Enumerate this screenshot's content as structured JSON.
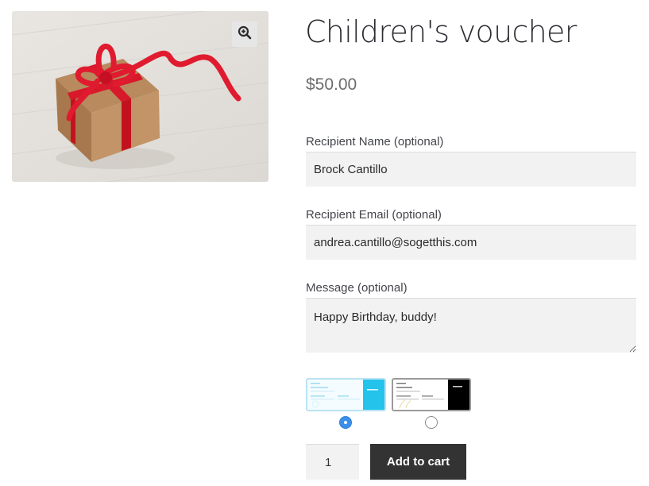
{
  "product": {
    "title": "Children's voucher",
    "price": "$50.00",
    "image_icon": "gift-box-with-red-ribbon",
    "zoom_icon": "magnifier-plus-icon"
  },
  "form": {
    "recipient_name": {
      "label": "Recipient Name (optional)",
      "value": "Brock Cantillo"
    },
    "recipient_email": {
      "label": "Recipient Email (optional)",
      "value": "andrea.cantillo@sogetthis.com"
    },
    "message": {
      "label": "Message (optional)",
      "value": "Happy Birthday, buddy!"
    }
  },
  "templates": {
    "options": [
      {
        "name": "blue-template",
        "selected": true,
        "accent": "#23c3ec"
      },
      {
        "name": "black-template",
        "selected": false,
        "accent": "#000000"
      }
    ]
  },
  "cart": {
    "quantity": "1",
    "add_to_cart_label": "Add to cart",
    "button_color": "#333333"
  }
}
